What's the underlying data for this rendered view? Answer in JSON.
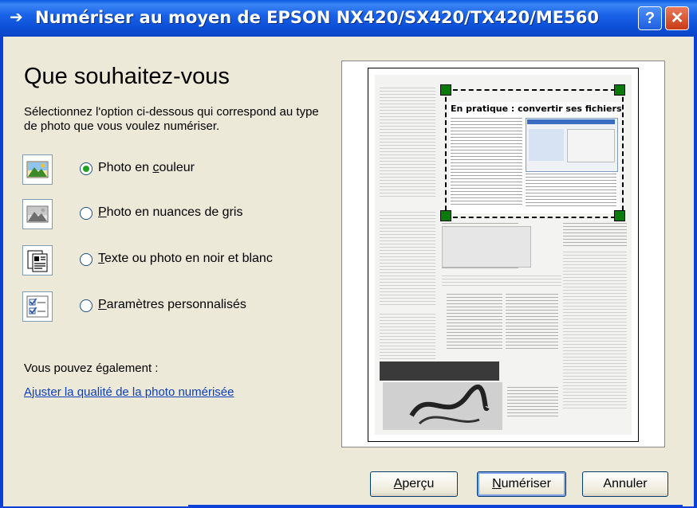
{
  "window": {
    "title": "Numériser au moyen de EPSON NX420/SX420/TX420/ME560",
    "help_label": "?",
    "close_label": "✕"
  },
  "main": {
    "heading": "Que souhaitez-vous",
    "description": "Sélectionnez l'option ci-dessous qui correspond au type de photo que vous voulez numériser.",
    "options": [
      {
        "pre": "Photo en ",
        "key": "c",
        "post": "ouleur",
        "checked": true,
        "icon": "color-photo-icon"
      },
      {
        "pre": "",
        "key": "P",
        "post": "hoto en nuances de gris",
        "checked": false,
        "icon": "grayscale-photo-icon"
      },
      {
        "pre": "",
        "key": "T",
        "post": "exte ou photo en noir et blanc",
        "checked": false,
        "icon": "bw-text-icon"
      },
      {
        "pre": "",
        "key": "P",
        "post": "aramètres personnalisés",
        "checked": false,
        "icon": "custom-settings-icon"
      }
    ],
    "also_text": "Vous pouvez également :",
    "adjust_link": "Ajuster la qualité de la photo numérisée"
  },
  "preview": {
    "article_title": "En pratique : convertir ses fichiers"
  },
  "buttons": {
    "preview": {
      "key": "A",
      "rest": "perçu"
    },
    "scan": {
      "key": "N",
      "rest": "umériser"
    },
    "cancel": {
      "label": "Annuler"
    }
  },
  "colors": {
    "titlebar": "#0b4fd6",
    "dialog_bg": "#ece9d8",
    "link": "#0b3ebd",
    "selection_handle": "#0a7a0a"
  }
}
